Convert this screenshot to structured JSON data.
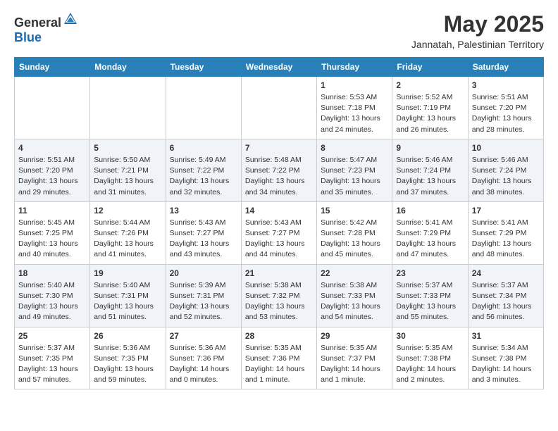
{
  "header": {
    "logo_general": "General",
    "logo_blue": "Blue",
    "month_year": "May 2025",
    "location": "Jannatah, Palestinian Territory"
  },
  "weekdays": [
    "Sunday",
    "Monday",
    "Tuesday",
    "Wednesday",
    "Thursday",
    "Friday",
    "Saturday"
  ],
  "weeks": [
    [
      {
        "day": "",
        "sunrise": "",
        "sunset": "",
        "daylight": ""
      },
      {
        "day": "",
        "sunrise": "",
        "sunset": "",
        "daylight": ""
      },
      {
        "day": "",
        "sunrise": "",
        "sunset": "",
        "daylight": ""
      },
      {
        "day": "",
        "sunrise": "",
        "sunset": "",
        "daylight": ""
      },
      {
        "day": "1",
        "sunrise": "Sunrise: 5:53 AM",
        "sunset": "Sunset: 7:18 PM",
        "daylight": "Daylight: 13 hours and 24 minutes."
      },
      {
        "day": "2",
        "sunrise": "Sunrise: 5:52 AM",
        "sunset": "Sunset: 7:19 PM",
        "daylight": "Daylight: 13 hours and 26 minutes."
      },
      {
        "day": "3",
        "sunrise": "Sunrise: 5:51 AM",
        "sunset": "Sunset: 7:20 PM",
        "daylight": "Daylight: 13 hours and 28 minutes."
      }
    ],
    [
      {
        "day": "4",
        "sunrise": "Sunrise: 5:51 AM",
        "sunset": "Sunset: 7:20 PM",
        "daylight": "Daylight: 13 hours and 29 minutes."
      },
      {
        "day": "5",
        "sunrise": "Sunrise: 5:50 AM",
        "sunset": "Sunset: 7:21 PM",
        "daylight": "Daylight: 13 hours and 31 minutes."
      },
      {
        "day": "6",
        "sunrise": "Sunrise: 5:49 AM",
        "sunset": "Sunset: 7:22 PM",
        "daylight": "Daylight: 13 hours and 32 minutes."
      },
      {
        "day": "7",
        "sunrise": "Sunrise: 5:48 AM",
        "sunset": "Sunset: 7:22 PM",
        "daylight": "Daylight: 13 hours and 34 minutes."
      },
      {
        "day": "8",
        "sunrise": "Sunrise: 5:47 AM",
        "sunset": "Sunset: 7:23 PM",
        "daylight": "Daylight: 13 hours and 35 minutes."
      },
      {
        "day": "9",
        "sunrise": "Sunrise: 5:46 AM",
        "sunset": "Sunset: 7:24 PM",
        "daylight": "Daylight: 13 hours and 37 minutes."
      },
      {
        "day": "10",
        "sunrise": "Sunrise: 5:46 AM",
        "sunset": "Sunset: 7:24 PM",
        "daylight": "Daylight: 13 hours and 38 minutes."
      }
    ],
    [
      {
        "day": "11",
        "sunrise": "Sunrise: 5:45 AM",
        "sunset": "Sunset: 7:25 PM",
        "daylight": "Daylight: 13 hours and 40 minutes."
      },
      {
        "day": "12",
        "sunrise": "Sunrise: 5:44 AM",
        "sunset": "Sunset: 7:26 PM",
        "daylight": "Daylight: 13 hours and 41 minutes."
      },
      {
        "day": "13",
        "sunrise": "Sunrise: 5:43 AM",
        "sunset": "Sunset: 7:27 PM",
        "daylight": "Daylight: 13 hours and 43 minutes."
      },
      {
        "day": "14",
        "sunrise": "Sunrise: 5:43 AM",
        "sunset": "Sunset: 7:27 PM",
        "daylight": "Daylight: 13 hours and 44 minutes."
      },
      {
        "day": "15",
        "sunrise": "Sunrise: 5:42 AM",
        "sunset": "Sunset: 7:28 PM",
        "daylight": "Daylight: 13 hours and 45 minutes."
      },
      {
        "day": "16",
        "sunrise": "Sunrise: 5:41 AM",
        "sunset": "Sunset: 7:29 PM",
        "daylight": "Daylight: 13 hours and 47 minutes."
      },
      {
        "day": "17",
        "sunrise": "Sunrise: 5:41 AM",
        "sunset": "Sunset: 7:29 PM",
        "daylight": "Daylight: 13 hours and 48 minutes."
      }
    ],
    [
      {
        "day": "18",
        "sunrise": "Sunrise: 5:40 AM",
        "sunset": "Sunset: 7:30 PM",
        "daylight": "Daylight: 13 hours and 49 minutes."
      },
      {
        "day": "19",
        "sunrise": "Sunrise: 5:40 AM",
        "sunset": "Sunset: 7:31 PM",
        "daylight": "Daylight: 13 hours and 51 minutes."
      },
      {
        "day": "20",
        "sunrise": "Sunrise: 5:39 AM",
        "sunset": "Sunset: 7:31 PM",
        "daylight": "Daylight: 13 hours and 52 minutes."
      },
      {
        "day": "21",
        "sunrise": "Sunrise: 5:38 AM",
        "sunset": "Sunset: 7:32 PM",
        "daylight": "Daylight: 13 hours and 53 minutes."
      },
      {
        "day": "22",
        "sunrise": "Sunrise: 5:38 AM",
        "sunset": "Sunset: 7:33 PM",
        "daylight": "Daylight: 13 hours and 54 minutes."
      },
      {
        "day": "23",
        "sunrise": "Sunrise: 5:37 AM",
        "sunset": "Sunset: 7:33 PM",
        "daylight": "Daylight: 13 hours and 55 minutes."
      },
      {
        "day": "24",
        "sunrise": "Sunrise: 5:37 AM",
        "sunset": "Sunset: 7:34 PM",
        "daylight": "Daylight: 13 hours and 56 minutes."
      }
    ],
    [
      {
        "day": "25",
        "sunrise": "Sunrise: 5:37 AM",
        "sunset": "Sunset: 7:35 PM",
        "daylight": "Daylight: 13 hours and 57 minutes."
      },
      {
        "day": "26",
        "sunrise": "Sunrise: 5:36 AM",
        "sunset": "Sunset: 7:35 PM",
        "daylight": "Daylight: 13 hours and 59 minutes."
      },
      {
        "day": "27",
        "sunrise": "Sunrise: 5:36 AM",
        "sunset": "Sunset: 7:36 PM",
        "daylight": "Daylight: 14 hours and 0 minutes."
      },
      {
        "day": "28",
        "sunrise": "Sunrise: 5:35 AM",
        "sunset": "Sunset: 7:36 PM",
        "daylight": "Daylight: 14 hours and 1 minute."
      },
      {
        "day": "29",
        "sunrise": "Sunrise: 5:35 AM",
        "sunset": "Sunset: 7:37 PM",
        "daylight": "Daylight: 14 hours and 1 minute."
      },
      {
        "day": "30",
        "sunrise": "Sunrise: 5:35 AM",
        "sunset": "Sunset: 7:38 PM",
        "daylight": "Daylight: 14 hours and 2 minutes."
      },
      {
        "day": "31",
        "sunrise": "Sunrise: 5:34 AM",
        "sunset": "Sunset: 7:38 PM",
        "daylight": "Daylight: 14 hours and 3 minutes."
      }
    ]
  ]
}
